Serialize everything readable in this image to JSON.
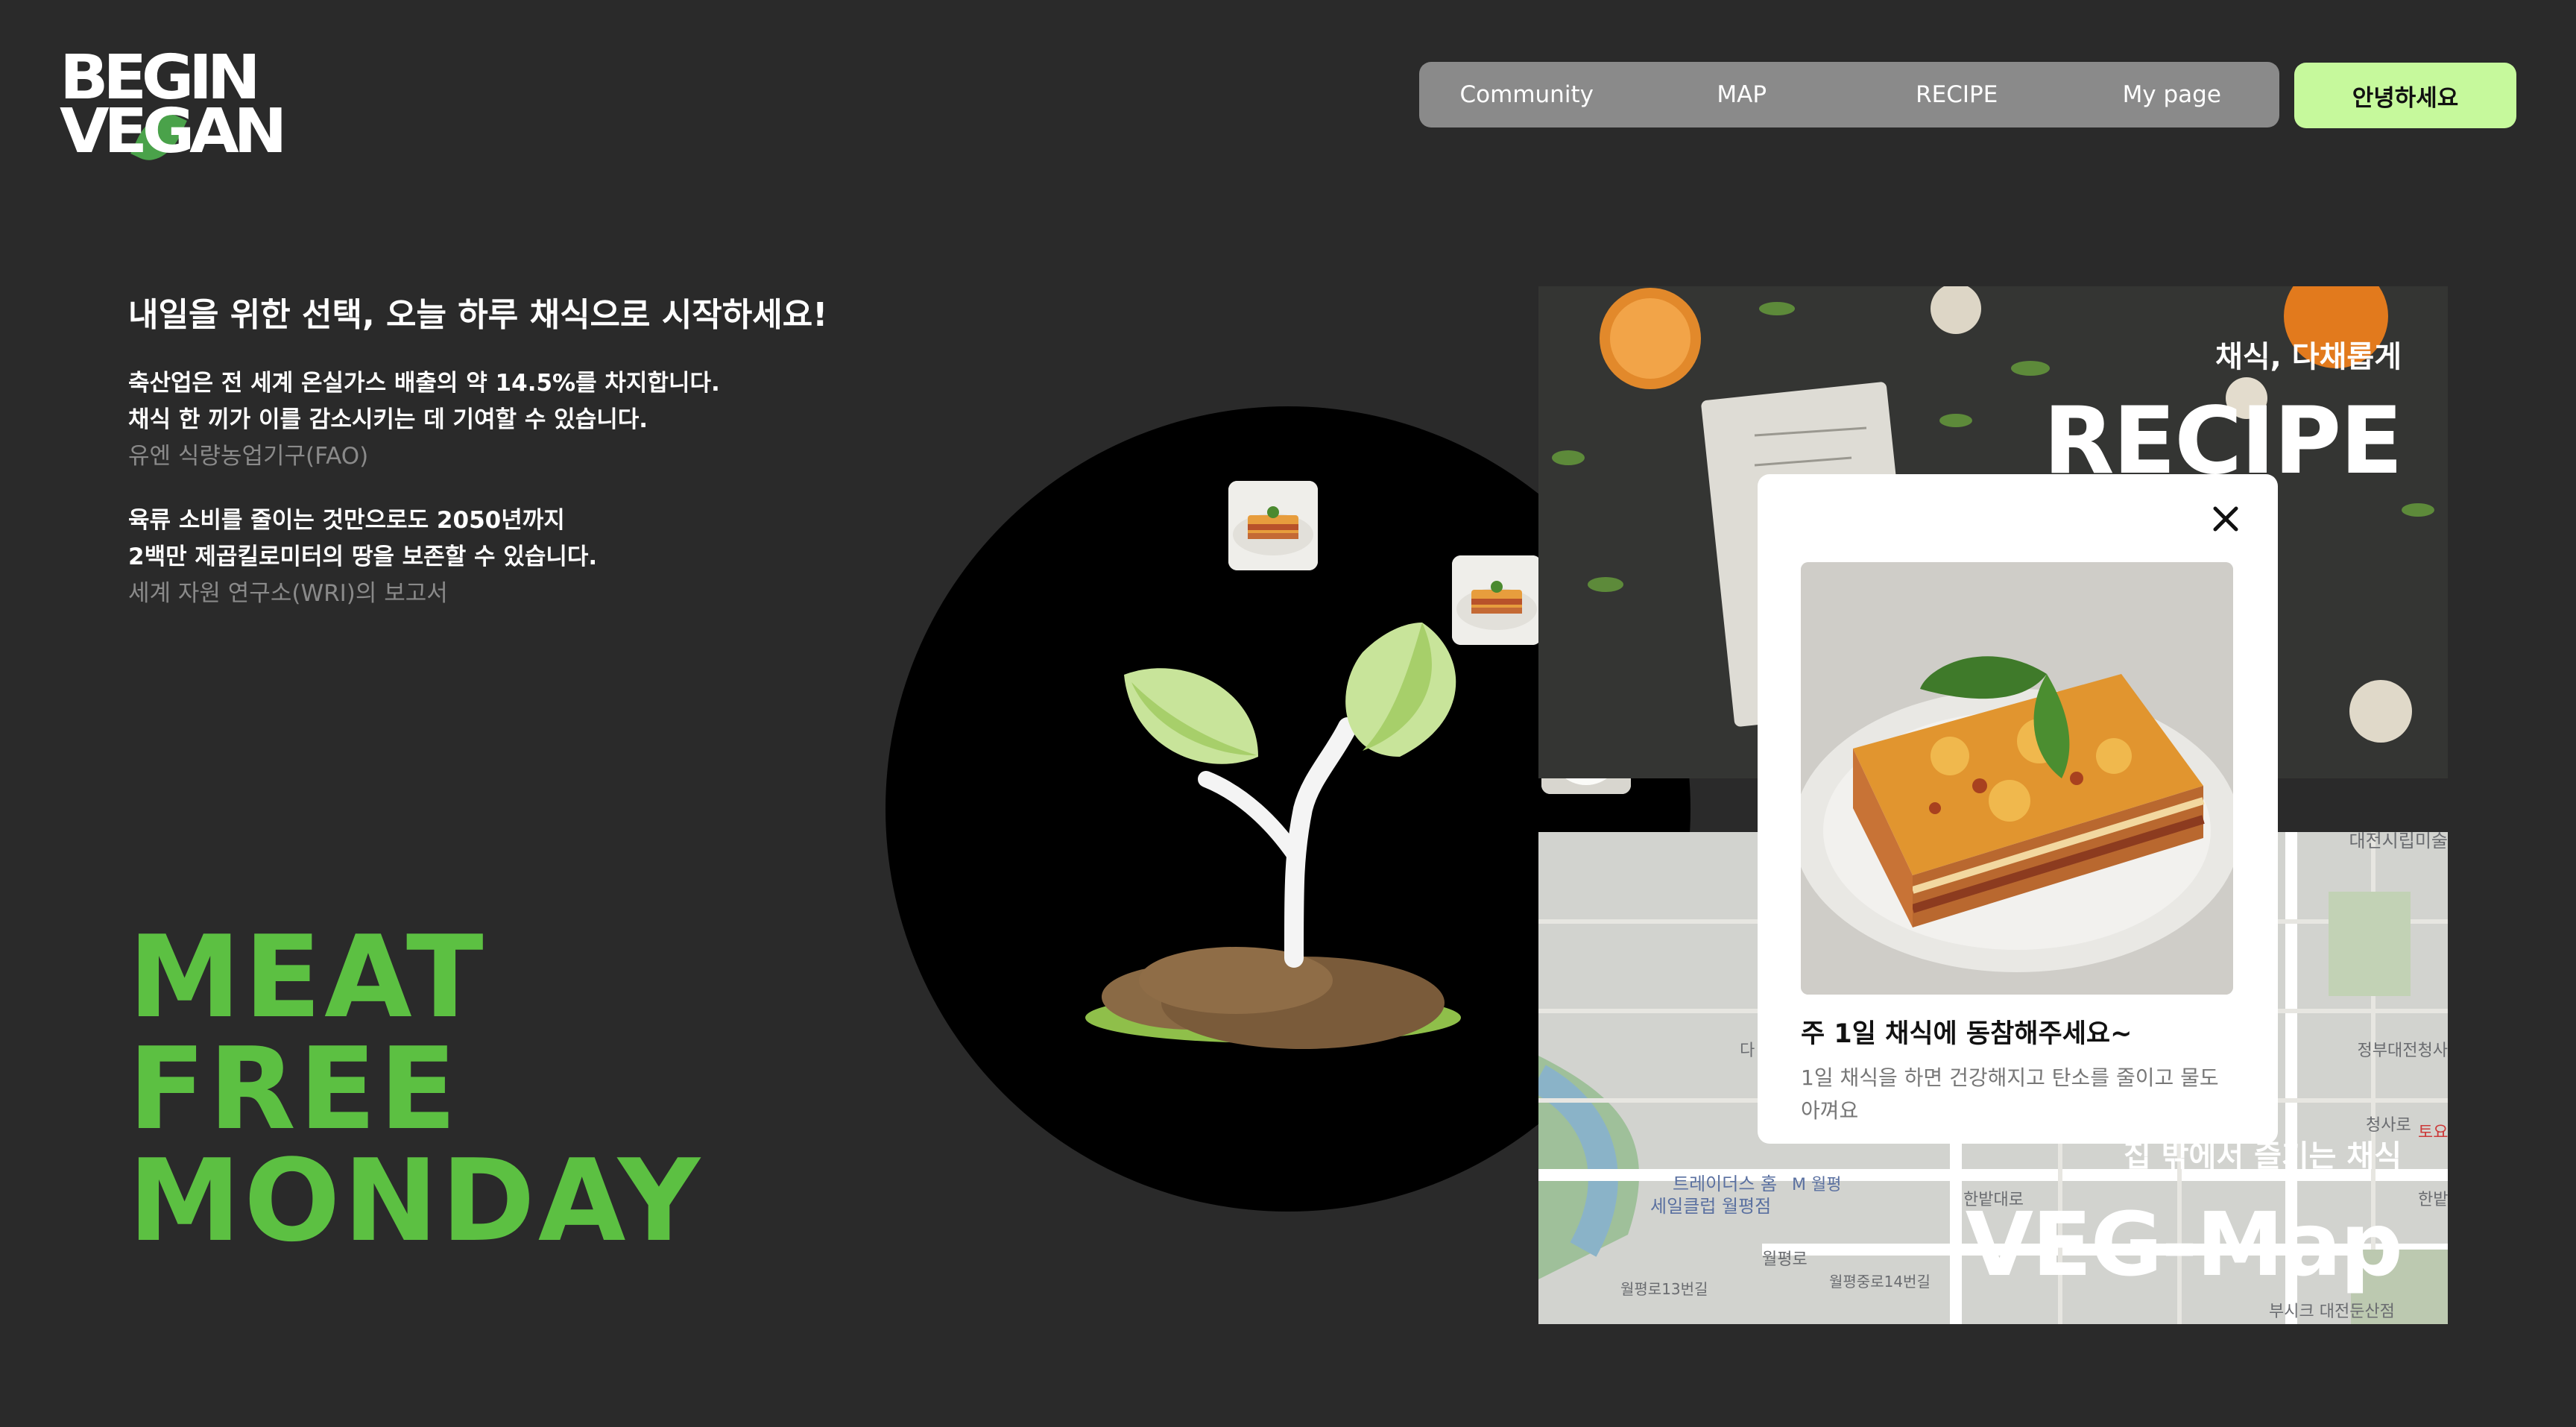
{
  "logo": {
    "line1": "BEGIN",
    "line2": "VEGAN"
  },
  "nav": {
    "items": [
      {
        "label": "Community"
      },
      {
        "label": "MAP"
      },
      {
        "label": "RECIPE"
      },
      {
        "label": "My page"
      }
    ],
    "greeting_button": "안녕하세요"
  },
  "hero": {
    "headline": "내일을 위한 선택, 오늘 하루 채식으로 시작하세요!",
    "fact1": {
      "line1": "축산업은 전 세계 온실가스 배출의 약 14.5%를 차지합니다.",
      "line2": "채식 한 끼가 이를 감소시키는 데 기여할 수 있습니다.",
      "source": "유엔 식량농업기구(FAO)"
    },
    "fact2": {
      "line1": "육류 소비를 줄이는 것만으로도 2050년까지",
      "line2": "2백만 제곱킬로미터의 땅을 보존할 수 있습니다.",
      "source": "세계 자원 연구소(WRI)의 보고서"
    },
    "slogan": [
      "MEAT",
      "FREE",
      "MONDAY"
    ]
  },
  "panels": {
    "recipe": {
      "subtitle": "채식, 다채롭게",
      "title": "RECIPE"
    },
    "map": {
      "subtitle": "집 밖에서 즐기는 채식",
      "title": "VEG-Map",
      "map_labels": [
        "대전시립미술",
        "정부대전청사",
        "청사로",
        "토요",
        "한밭",
        "트레이더스 홈",
        "세일클럽 월평점",
        "M 월평",
        "한밭대로",
        "월평로",
        "월평로13번길",
        "월평중로14번길",
        "부시크 대전둔산점",
        "다"
      ]
    }
  },
  "popup": {
    "title": "주 1일 채식에 동참해주세요~",
    "description": "1일 채식을 하면 건강해지고 탄소를 줄이고 물도 아껴요"
  },
  "colors": {
    "background": "#2a2a2a",
    "accent_green": "#5cc042",
    "greeting_button": "#c6f99c",
    "nav_bg": "#8a8a8a"
  }
}
